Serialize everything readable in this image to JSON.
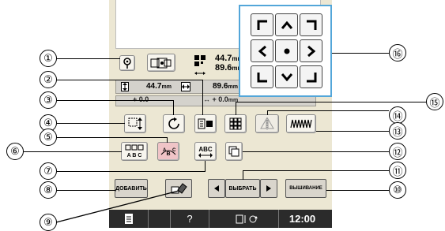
{
  "callouts": {
    "c1": "①",
    "c2": "②",
    "c3": "③",
    "c4": "④",
    "c5": "⑤",
    "c6": "⑥",
    "c7": "⑦",
    "c8": "⑧",
    "c9": "⑨",
    "c10": "⑩",
    "c11": "⑪",
    "c12": "⑫",
    "c13": "⑬",
    "c14": "⑭",
    "c15": "⑮",
    "c16": "⑯"
  },
  "info": {
    "width_value": "44.7",
    "height_value": "89.6",
    "unit": "mm",
    "row2_left_value": "44.7",
    "row2_right_value": "89.6",
    "row3_left_value": "0.0",
    "row3_right_value": "0.0"
  },
  "buttons": {
    "add_label": "ДОБАВИТЬ",
    "select_label": "ВЫБРАТЬ",
    "embroider_label": "ВЫШИВАНИЕ",
    "abc_label": "ABC"
  },
  "bottom_bar": {
    "help": "?",
    "time": "12:00"
  },
  "colors": {
    "screen_bg": "#ece7d3",
    "arrow_pad_border": "#53a6d9",
    "bottom_bar": "#2b2b2b"
  }
}
